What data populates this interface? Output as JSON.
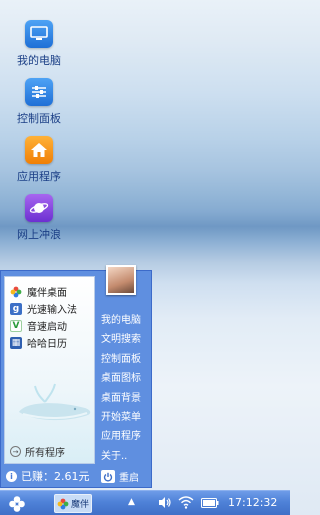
{
  "desktop": {
    "icons": [
      {
        "label": "我的电脑",
        "icon": "computer-icon"
      },
      {
        "label": "控制面板",
        "icon": "control-panel-icon"
      },
      {
        "label": "应用程序",
        "icon": "home-apps-icon"
      },
      {
        "label": "网上冲浪",
        "icon": "surf-planet-icon"
      }
    ]
  },
  "start_menu": {
    "left_items": [
      {
        "label": "魔伴桌面",
        "icon": "flower-icon"
      },
      {
        "label": "光速输入法",
        "icon": "input-method-icon"
      },
      {
        "label": "音速启动",
        "icon": "launcher-icon"
      },
      {
        "label": "哈哈日历",
        "icon": "calendar-icon"
      }
    ],
    "all_programs": "所有程序",
    "right_items": [
      "我的电脑",
      "文明搜索",
      "控制面板",
      "桌面图标",
      "桌面背景",
      "开始菜单",
      "应用程序",
      "关于.."
    ],
    "earned": "已赚：2.61元",
    "restart": "重启"
  },
  "taskbar": {
    "app_label": "魔伴",
    "clock": "17:12:32"
  },
  "colors": {
    "menu_blue": "#5f8fe0",
    "taskbar_blue": "#4f82d8",
    "desktop_label": "#1b3f86"
  }
}
